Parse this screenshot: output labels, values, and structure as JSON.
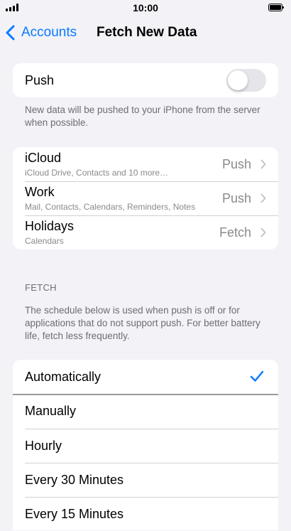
{
  "status_bar": {
    "time": "10:00",
    "icons": [
      "signal-icon",
      "battery-icon"
    ]
  },
  "nav": {
    "back_label": "Accounts",
    "title": "Fetch New Data",
    "back_icon": "chevron-left-icon"
  },
  "push": {
    "label": "Push",
    "enabled": false,
    "note": "New data will be pushed to your iPhone from the server when possible."
  },
  "accounts": [
    {
      "name": "iCloud",
      "detail": "iCloud Drive, Contacts and 10 more…",
      "value": "Push"
    },
    {
      "name": "Work",
      "detail": "Mail, Contacts, Calendars, Reminders, Notes",
      "value": "Push"
    },
    {
      "name": "Holidays",
      "detail": "Calendars",
      "value": "Fetch"
    }
  ],
  "fetch": {
    "header": "FETCH",
    "note": "The schedule below is used when push is off or for applications that do not support push. For better battery life, fetch less frequently.",
    "options": [
      "Automatically",
      "Manually",
      "Hourly",
      "Every 30 Minutes",
      "Every 15 Minutes"
    ],
    "selected": "Automatically"
  },
  "colors": {
    "accent": "#0a7aff",
    "background": "#f2f2f7",
    "secondary_text": "#8a8a8e"
  }
}
